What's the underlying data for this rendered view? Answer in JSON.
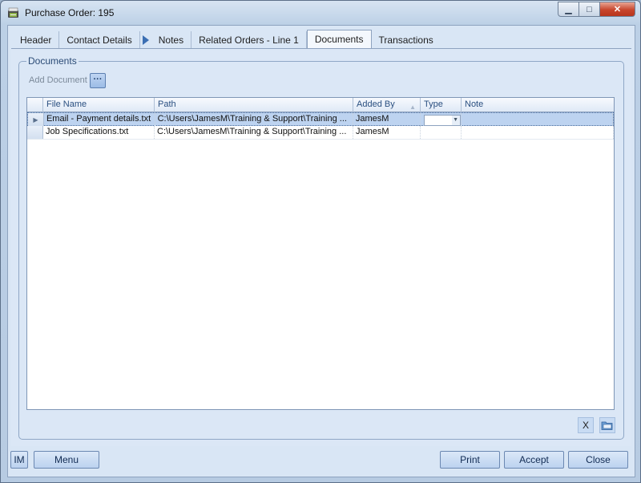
{
  "window": {
    "title": "Purchase Order: 195",
    "minimize": "▁",
    "maximize": "□",
    "close": "✕"
  },
  "tabs": [
    {
      "label": "Header"
    },
    {
      "label": "Contact Details"
    },
    {
      "label": "Notes"
    },
    {
      "label": "Related Orders - Line 1"
    },
    {
      "label": "Documents",
      "active": true
    },
    {
      "label": "Transactions"
    }
  ],
  "documents": {
    "group_title": "Documents",
    "add_document_label": "Add Document",
    "browse_button": "···",
    "columns": [
      "File Name",
      "Path",
      "Added By",
      "Type",
      "Note"
    ],
    "rows": [
      {
        "file_name": "Email - Payment details.txt",
        "path": "C:\\Users\\JamesM\\Training & Support\\Training ...",
        "added_by": "JamesM",
        "type": "",
        "note": "",
        "current": true
      },
      {
        "file_name": "Job Specifications.txt",
        "path": "C:\\Users\\JamesM\\Training & Support\\Training ...",
        "added_by": "JamesM",
        "type": "",
        "note": "",
        "current": false
      }
    ],
    "delete_button": "X"
  },
  "footer": {
    "im_label": "IM",
    "menu_label": "Menu",
    "print_label": "Print",
    "accept_label": "Accept",
    "close_label": "Close"
  },
  "colors": {
    "accent": "#bdd3f0",
    "header_text": "#2a4f80"
  }
}
